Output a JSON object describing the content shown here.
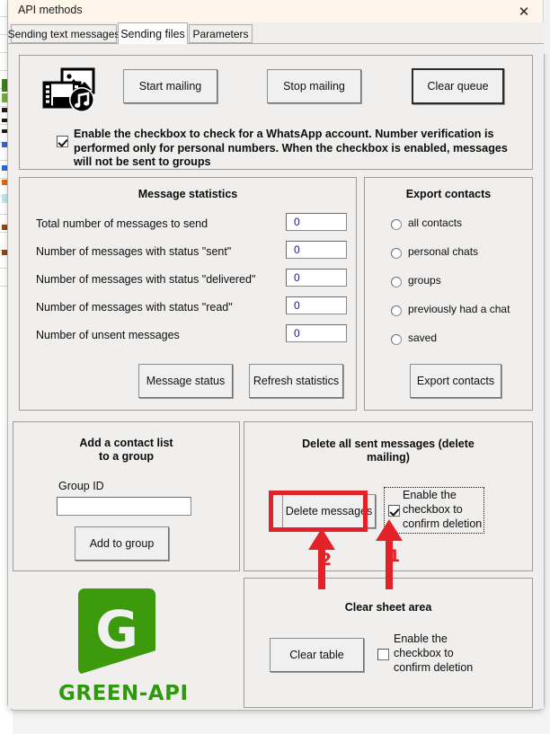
{
  "window": {
    "title": "API methods",
    "close_label": "✕"
  },
  "tabs": [
    {
      "label": "Sending text messages",
      "active": false
    },
    {
      "label": "Sending files",
      "active": true
    },
    {
      "label": "Parameters",
      "active": false
    }
  ],
  "mailing_panel": {
    "icon": "media-files-icon",
    "buttons": [
      {
        "label": "Start mailing",
        "focused": false
      },
      {
        "label": "Stop mailing",
        "focused": false
      },
      {
        "label": "Clear queue",
        "focused": true
      }
    ],
    "checkbox": {
      "checked": true,
      "label": "Enable the checkbox to check for a WhatsApp account. Number verification is performed only for personal numbers. When the checkbox is enabled, messages will not be sent to groups"
    }
  },
  "message_statistics": {
    "title": "Message statistics",
    "rows": [
      {
        "label": "Total number of messages to send",
        "value": "0"
      },
      {
        "label": "Number of messages with status \"sent\"",
        "value": "0"
      },
      {
        "label": "Number of messages with status \"delivered\"",
        "value": "0"
      },
      {
        "label": "Number of messages with status \"read\"",
        "value": "0"
      },
      {
        "label": "Number of unsent messages",
        "value": "0"
      }
    ],
    "buttons": [
      {
        "label": "Message status"
      },
      {
        "label": "Refresh statistics"
      }
    ]
  },
  "export_contacts": {
    "title": "Export contacts",
    "options": [
      {
        "label": "all contacts",
        "selected": false
      },
      {
        "label": "personal chats",
        "selected": false
      },
      {
        "label": "groups",
        "selected": false
      },
      {
        "label": "previously had a chat",
        "selected": false
      },
      {
        "label": "saved",
        "selected": false
      }
    ],
    "button": "Export contacts"
  },
  "add_contact_list": {
    "title_line1": "Add a contact list",
    "title_line2": "to a group",
    "field_label": "Group ID",
    "field_value": "",
    "button": "Add to group"
  },
  "delete_messages": {
    "title_line1": "Delete all sent messages (delete",
    "title_line2": "mailing)",
    "button": "Delete messages",
    "checkbox": {
      "checked": true,
      "label_line1": "Enable the",
      "label_line2": "checkbox to",
      "label_line3": "confirm deletion"
    }
  },
  "clear_sheet": {
    "title": "Clear sheet area",
    "button": "Clear table",
    "checkbox": {
      "checked": false,
      "label_line1": "Enable the",
      "label_line2": "checkbox to",
      "label_line3": "confirm deletion"
    }
  },
  "branding": {
    "mark_letter": "G",
    "wordmark": "GREEN-API",
    "green": "#3d9a0d"
  },
  "annotations": {
    "accent": "#e22128",
    "steps": [
      {
        "number": "1",
        "target": "confirm-deletion-checkbox"
      },
      {
        "number": "2",
        "target": "delete-messages-button"
      }
    ]
  }
}
